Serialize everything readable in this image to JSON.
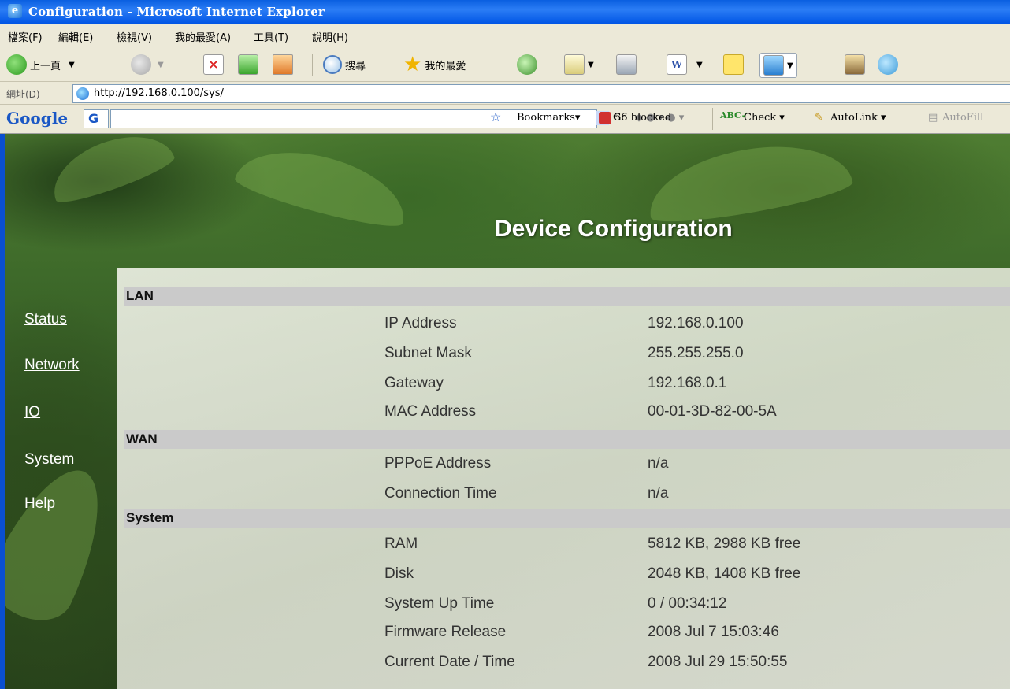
{
  "window": {
    "title": "Configuration - Microsoft Internet Explorer"
  },
  "menu": [
    "檔案(F)",
    "編輯(E)",
    "檢視(V)",
    "我的最愛(A)",
    "工具(T)",
    "說明(H)"
  ],
  "toolbar": {
    "back_label": "上一頁",
    "search_label": "搜尋",
    "favorites_label": "我的最愛"
  },
  "address": {
    "label": "網址(D)",
    "url": "http://192.168.0.100/sys/"
  },
  "googlebar": {
    "logo": "Google",
    "go_label": "Go",
    "bookmarks_label": "Bookmarks▾",
    "blocked_label": "56 blocked",
    "check_label": "Check ▾",
    "autolink_label": "AutoLink ▾",
    "autofill_label": "AutoFill"
  },
  "page": {
    "title": "Device Configuration",
    "nav": [
      "Status",
      "Network",
      "IO",
      "System",
      "Help"
    ],
    "sections": [
      {
        "name": "LAN",
        "rows": [
          {
            "label": "IP Address",
            "value": "192.168.0.100"
          },
          {
            "label": "Subnet Mask",
            "value": "255.255.255.0"
          },
          {
            "label": "Gateway",
            "value": "192.168.0.1"
          },
          {
            "label": "MAC Address",
            "value": "00-01-3D-82-00-5A"
          }
        ]
      },
      {
        "name": "WAN",
        "rows": [
          {
            "label": "PPPoE Address",
            "value": "n/a"
          },
          {
            "label": "Connection Time",
            "value": "n/a"
          }
        ]
      },
      {
        "name": "System",
        "rows": [
          {
            "label": "RAM",
            "value": "5812 KB, 2988 KB free"
          },
          {
            "label": "Disk",
            "value": "2048 KB, 1408 KB free"
          },
          {
            "label": "System Up Time",
            "value": "0 / 00:34:12"
          },
          {
            "label": "Firmware Release",
            "value": "2008 Jul 7 15:03:46"
          },
          {
            "label": "Current Date / Time",
            "value": "2008 Jul 29 15:50:55"
          }
        ]
      }
    ]
  }
}
